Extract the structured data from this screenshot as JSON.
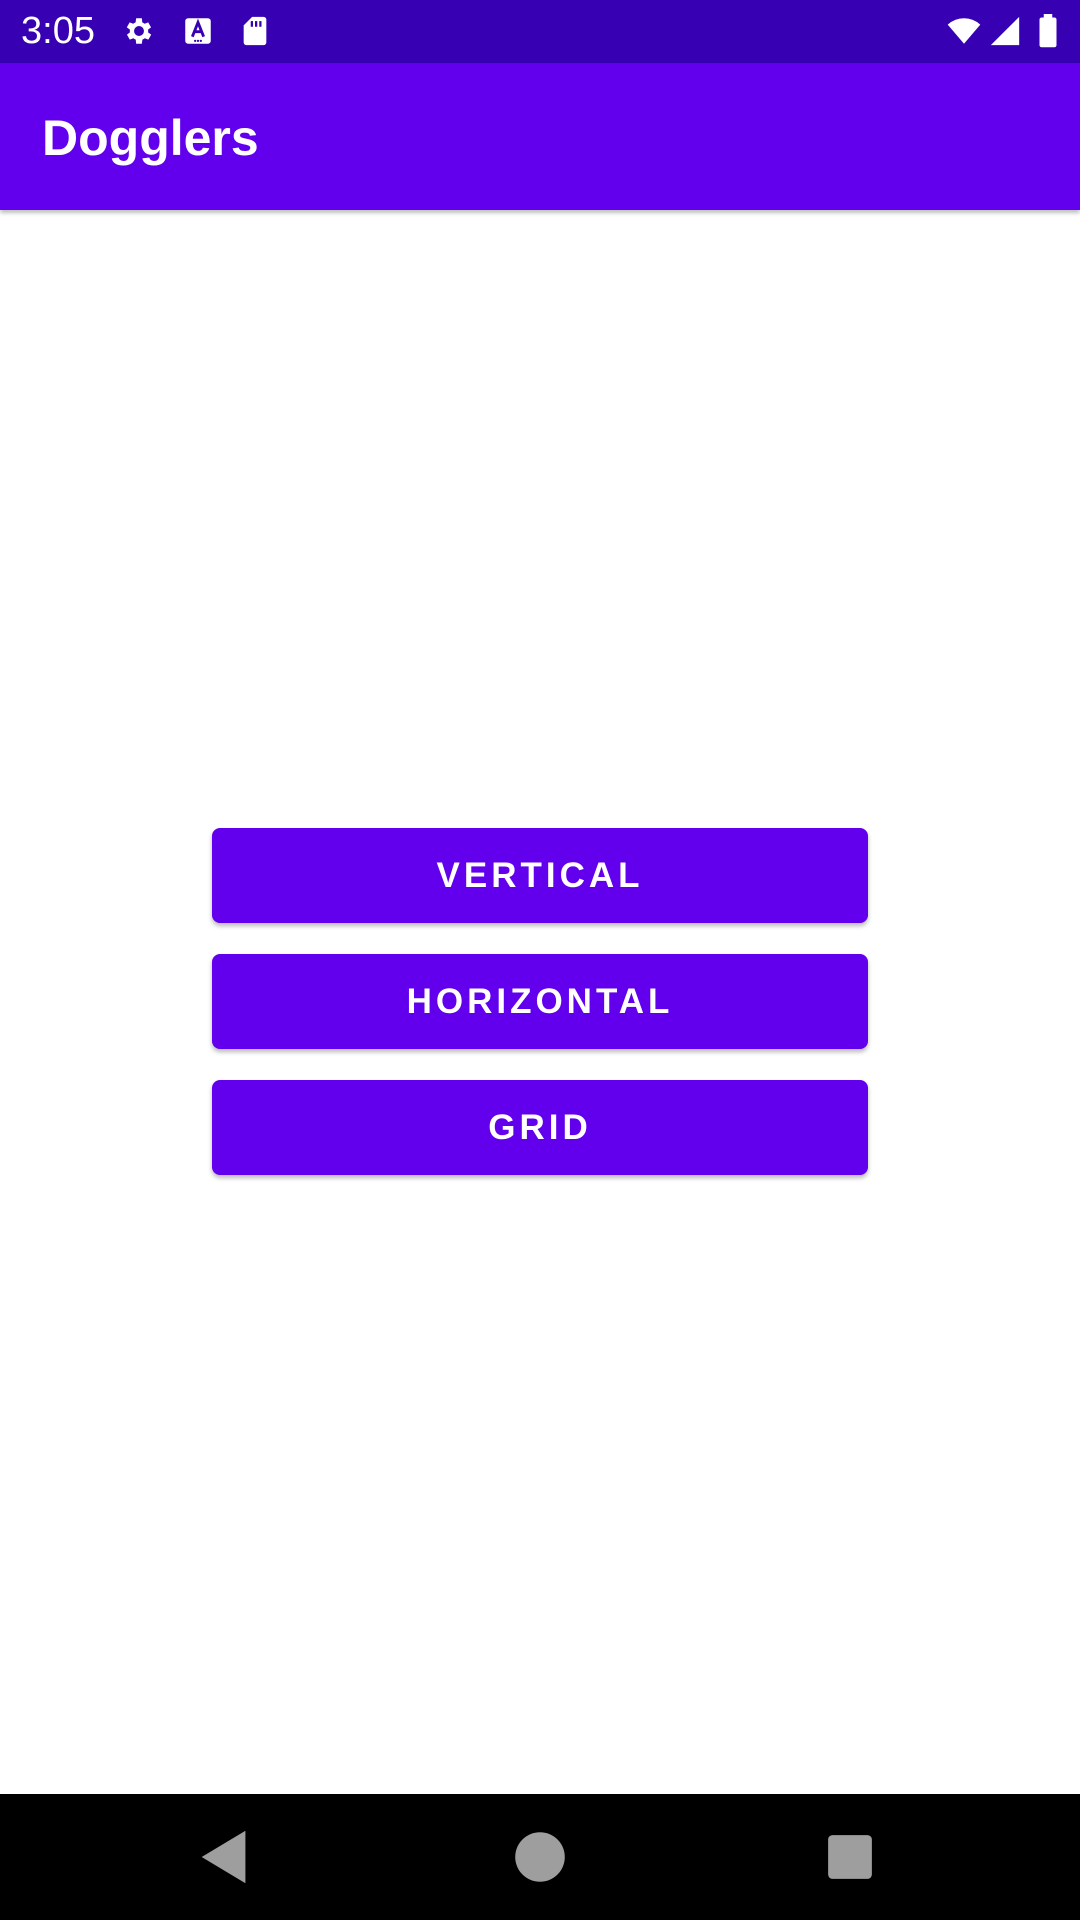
{
  "status_bar": {
    "time": "3:05",
    "left_icons": [
      "settings-icon",
      "keyboard-a-icon",
      "sd-card-icon"
    ],
    "right_icons": [
      "wifi-icon",
      "cell-signal-icon",
      "battery-icon"
    ],
    "background": "#3700b3"
  },
  "app_bar": {
    "title": "Dogglers",
    "background": "#6200ee"
  },
  "buttons": {
    "vertical": "VERTICAL",
    "horizontal": "HORIZONTAL",
    "grid": "GRID",
    "color": "#6200ee"
  },
  "nav_bar": {
    "items": [
      "back-icon",
      "home-icon",
      "recents-icon"
    ]
  }
}
